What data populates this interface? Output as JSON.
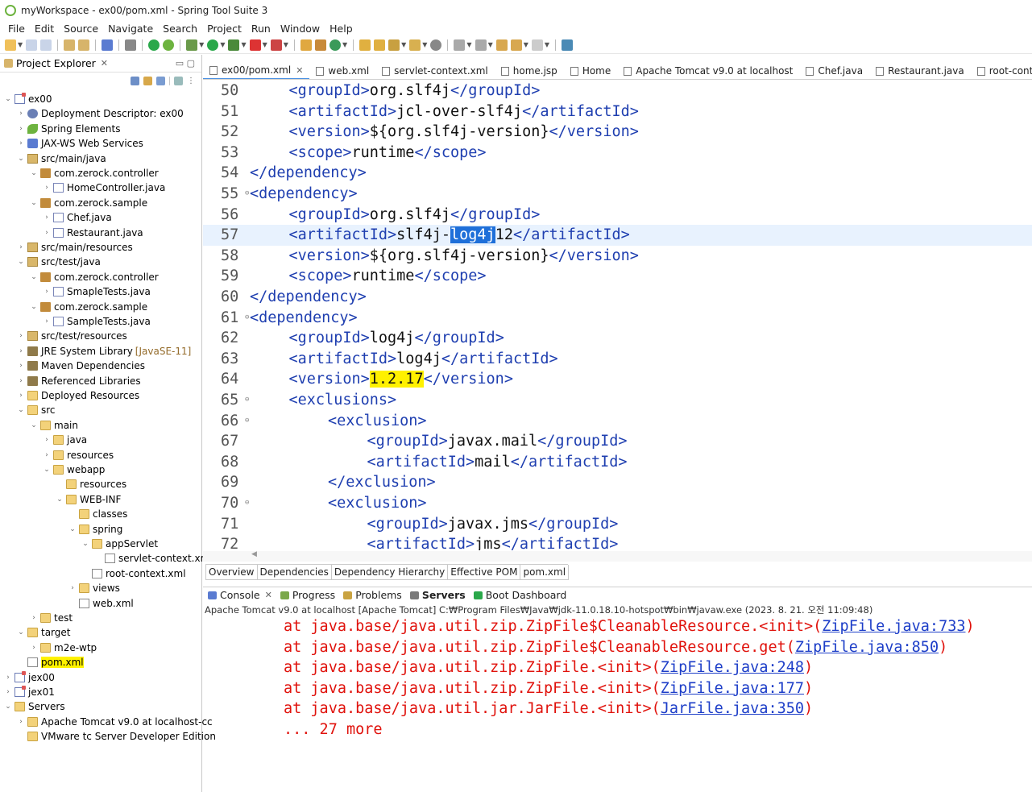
{
  "window": {
    "title": "myWorkspace - ex00/pom.xml - Spring Tool Suite 3"
  },
  "menu": [
    "File",
    "Edit",
    "Source",
    "Navigate",
    "Search",
    "Project",
    "Run",
    "Window",
    "Help"
  ],
  "explorer": {
    "title": "Project Explorer",
    "items": [
      {
        "label": "ex00",
        "twisty": "⌄",
        "icon": "project-icon"
      },
      {
        "label": "Deployment Descriptor: ex00",
        "twisty": "›",
        "icon": "descriptor-icon"
      },
      {
        "label": "Spring Elements",
        "twisty": "›",
        "icon": "spring-icon"
      },
      {
        "label": "JAX-WS Web Services",
        "twisty": "›",
        "icon": "webservice-icon"
      },
      {
        "label": "src/main/java",
        "twisty": "⌄",
        "icon": "source-folder-icon"
      },
      {
        "label": "com.zerock.controller",
        "twisty": "⌄",
        "icon": "package-icon"
      },
      {
        "label": "HomeController.java",
        "twisty": "›",
        "icon": "java-file-icon"
      },
      {
        "label": "com.zerock.sample",
        "twisty": "⌄",
        "icon": "package-icon"
      },
      {
        "label": "Chef.java",
        "twisty": "›",
        "icon": "java-file-icon"
      },
      {
        "label": "Restaurant.java",
        "twisty": "›",
        "icon": "java-file-icon"
      },
      {
        "label": "src/main/resources",
        "twisty": "›",
        "icon": "source-folder-icon"
      },
      {
        "label": "src/test/java",
        "twisty": "⌄",
        "icon": "source-folder-icon"
      },
      {
        "label": "com.zerock.controller",
        "twisty": "⌄",
        "icon": "package-icon"
      },
      {
        "label": "SmapleTests.java",
        "twisty": "›",
        "icon": "java-file-icon"
      },
      {
        "label": "com.zerock.sample",
        "twisty": "⌄",
        "icon": "package-icon"
      },
      {
        "label": "SampleTests.java",
        "twisty": "›",
        "icon": "java-file-icon"
      },
      {
        "label": "src/test/resources",
        "twisty": "›",
        "icon": "source-folder-icon"
      },
      {
        "label": "JRE System Library",
        "suffix": "[JavaSE-11]",
        "twisty": "›",
        "icon": "library-icon"
      },
      {
        "label": "Maven Dependencies",
        "twisty": "›",
        "icon": "library-icon"
      },
      {
        "label": "Referenced Libraries",
        "twisty": "›",
        "icon": "library-icon"
      },
      {
        "label": "Deployed Resources",
        "twisty": "›",
        "icon": "deployed-icon"
      },
      {
        "label": "src",
        "twisty": "⌄",
        "icon": "folder-icon"
      },
      {
        "label": "main",
        "twisty": "⌄",
        "icon": "folder-icon"
      },
      {
        "label": "java",
        "twisty": "›",
        "icon": "folder-icon"
      },
      {
        "label": "resources",
        "twisty": "›",
        "icon": "folder-icon"
      },
      {
        "label": "webapp",
        "twisty": "⌄",
        "icon": "folder-icon"
      },
      {
        "label": "resources",
        "twisty": "",
        "icon": "folder-icon"
      },
      {
        "label": "WEB-INF",
        "twisty": "⌄",
        "icon": "folder-icon"
      },
      {
        "label": "classes",
        "twisty": "",
        "icon": "folder-icon"
      },
      {
        "label": "spring",
        "twisty": "⌄",
        "icon": "folder-icon"
      },
      {
        "label": "appServlet",
        "twisty": "⌄",
        "icon": "folder-icon"
      },
      {
        "label": "servlet-context.xml",
        "twisty": "",
        "icon": "xml-file-icon"
      },
      {
        "label": "root-context.xml",
        "twisty": "",
        "icon": "xml-file-icon"
      },
      {
        "label": "views",
        "twisty": "›",
        "icon": "folder-icon"
      },
      {
        "label": "web.xml",
        "twisty": "",
        "icon": "xml-file-icon"
      },
      {
        "label": "test",
        "twisty": "›",
        "icon": "folder-icon"
      },
      {
        "label": "target",
        "twisty": "⌄",
        "icon": "folder-icon"
      },
      {
        "label": "m2e-wtp",
        "twisty": "›",
        "icon": "folder-icon"
      },
      {
        "label": "pom.xml",
        "twisty": "",
        "icon": "xml-file-icon",
        "highlight": true
      },
      {
        "label": "jex00",
        "twisty": "›",
        "icon": "project-icon"
      },
      {
        "label": "jex01",
        "twisty": "›",
        "icon": "project-icon"
      },
      {
        "label": "Servers",
        "twisty": "⌄",
        "icon": "folder-icon"
      },
      {
        "label": "Apache Tomcat v9.0  at localhost-cc",
        "twisty": "›",
        "icon": "folder-icon"
      },
      {
        "label": "VMware tc Server Developer Edition",
        "twisty": "",
        "icon": "folder-icon"
      }
    ]
  },
  "editor_tabs": [
    {
      "label": "ex00/pom.xml",
      "active": true,
      "close": "✕"
    },
    {
      "label": "web.xml"
    },
    {
      "label": "servlet-context.xml"
    },
    {
      "label": "home.jsp"
    },
    {
      "label": "Home"
    },
    {
      "label": "Apache Tomcat v9.0  at localhost"
    },
    {
      "label": "Chef.java"
    },
    {
      "label": "Restaurant.java"
    },
    {
      "label": "root-context.x"
    }
  ],
  "code_lines": [
    {
      "n": "50",
      "indent": 3,
      "open": "groupId",
      "text": "org.slf4j"
    },
    {
      "n": "51",
      "indent": 3,
      "open": "artifactId",
      "text": "jcl-over-slf4j"
    },
    {
      "n": "52",
      "indent": 3,
      "open": "version",
      "text": "${org.slf4j-version}"
    },
    {
      "n": "53",
      "indent": 3,
      "open": "scope",
      "text": "runtime"
    },
    {
      "n": "54",
      "indent": 2,
      "close_only": "dependency"
    },
    {
      "n": "55",
      "indent": 2,
      "open_only": "dependency",
      "fold": true
    },
    {
      "n": "56",
      "indent": 3,
      "open": "groupId",
      "text": "org.slf4j"
    },
    {
      "n": "57",
      "indent": 3,
      "open": "artifactId",
      "text_pre": "slf4j-",
      "text_sel": "log4j",
      "text_post": "12",
      "current": true
    },
    {
      "n": "58",
      "indent": 3,
      "open": "version",
      "text": "${org.slf4j-version}"
    },
    {
      "n": "59",
      "indent": 3,
      "open": "scope",
      "text": "runtime"
    },
    {
      "n": "60",
      "indent": 2,
      "close_only": "dependency"
    },
    {
      "n": "61",
      "indent": 2,
      "open_only": "dependency",
      "fold": true
    },
    {
      "n": "62",
      "indent": 3,
      "open": "groupId",
      "text": "log4j"
    },
    {
      "n": "63",
      "indent": 3,
      "open": "artifactId",
      "text": "log4j"
    },
    {
      "n": "64",
      "indent": 3,
      "open": "version",
      "text": "1.2.17",
      "text_highlight": true
    },
    {
      "n": "65",
      "indent": 3,
      "open_only": "exclusions",
      "fold": true
    },
    {
      "n": "66",
      "indent": 4,
      "open_only": "exclusion",
      "fold": true
    },
    {
      "n": "67",
      "indent": 5,
      "open": "groupId",
      "text": "javax.mail"
    },
    {
      "n": "68",
      "indent": 5,
      "open": "artifactId",
      "text": "mail"
    },
    {
      "n": "69",
      "indent": 4,
      "close_only": "exclusion"
    },
    {
      "n": "70",
      "indent": 4,
      "open_only": "exclusion",
      "fold": true
    },
    {
      "n": "71",
      "indent": 5,
      "open": "groupId",
      "text": "javax.jms"
    },
    {
      "n": "72",
      "indent": 5,
      "open": "artifactId",
      "text": "jms"
    }
  ],
  "pom_tabs": [
    "Overview",
    "Dependencies",
    "Dependency Hierarchy",
    "Effective POM",
    "pom.xml"
  ],
  "console_tabs": [
    {
      "label": "Console",
      "close": "✕"
    },
    {
      "label": "Progress"
    },
    {
      "label": "Problems"
    },
    {
      "label": "Servers",
      "bold": true
    },
    {
      "label": "Boot Dashboard"
    }
  ],
  "console_desc": "Apache Tomcat v9.0  at localhost [Apache Tomcat] C:₩Program Files₩Java₩jdk-11.0.18.10-hotspot₩bin₩javaw.exe  (2023. 8. 21. 오전 11:09:48)",
  "console_lines": [
    {
      "pre": "at java.base/java.util.zip.ZipFile$CleanableResource.<init>(",
      "link": "ZipFile.java:733",
      "post": ")"
    },
    {
      "pre": "at java.base/java.util.zip.ZipFile$CleanableResource.get(",
      "link": "ZipFile.java:850",
      "post": ")"
    },
    {
      "pre": "at java.base/java.util.zip.ZipFile.<init>(",
      "link": "ZipFile.java:248",
      "post": ")"
    },
    {
      "pre": "at java.base/java.util.zip.ZipFile.<init>(",
      "link": "ZipFile.java:177",
      "post": ")"
    },
    {
      "pre": "at java.base/java.util.jar.JarFile.<init>(",
      "link": "JarFile.java:350",
      "post": ")"
    },
    {
      "pre": "... 27 more",
      "link": "",
      "post": ""
    }
  ]
}
